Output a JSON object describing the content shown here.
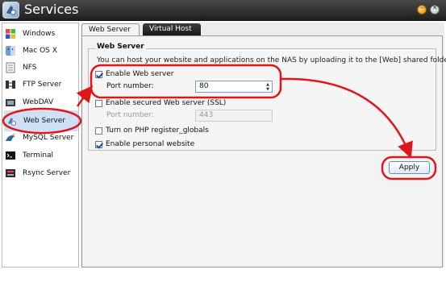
{
  "window": {
    "title": "Services",
    "icon": "services-app-icon",
    "minimize_icon": "minimize-icon",
    "close_icon": "close-icon"
  },
  "sidebar": {
    "items": [
      {
        "label": "Windows",
        "icon": "windows-icon"
      },
      {
        "label": "Mac OS X",
        "icon": "finder-icon"
      },
      {
        "label": "NFS",
        "icon": "nfs-icon"
      },
      {
        "label": "FTP Server",
        "icon": "ftp-icon"
      },
      {
        "label": "WebDAV",
        "icon": "webdav-icon"
      },
      {
        "label": "Web Server",
        "icon": "web-server-icon",
        "selected": true
      },
      {
        "label": "MySQL Server",
        "icon": "mysql-icon"
      },
      {
        "label": "Terminal",
        "icon": "terminal-icon"
      },
      {
        "label": "Rsync Server",
        "icon": "rsync-icon"
      }
    ]
  },
  "tabs": [
    {
      "label": "Web Server",
      "active": true
    },
    {
      "label": "Virtual Host",
      "active": false
    }
  ],
  "web_server": {
    "section_title": "Web Server",
    "description": "You can host your website and applications on the NAS by uploading it to the [Web] shared folder.",
    "enable_web_server": {
      "label": "Enable Web server",
      "checked": true
    },
    "port": {
      "label": "Port number:",
      "value": "80"
    },
    "enable_ssl": {
      "label": "Enable secured Web server (SSL)",
      "checked": false
    },
    "ssl_port": {
      "label": "Port number:",
      "value": "443",
      "disabled": true
    },
    "php_register_globals": {
      "label": "Turn on PHP register_globals",
      "checked": false
    },
    "personal_website": {
      "label": "Enable personal website",
      "checked": true
    }
  },
  "apply_label": "Apply",
  "colors": {
    "annotation": "#e0161b",
    "titlebar": "#2a2a2a",
    "selection": "#cfe0f5"
  }
}
